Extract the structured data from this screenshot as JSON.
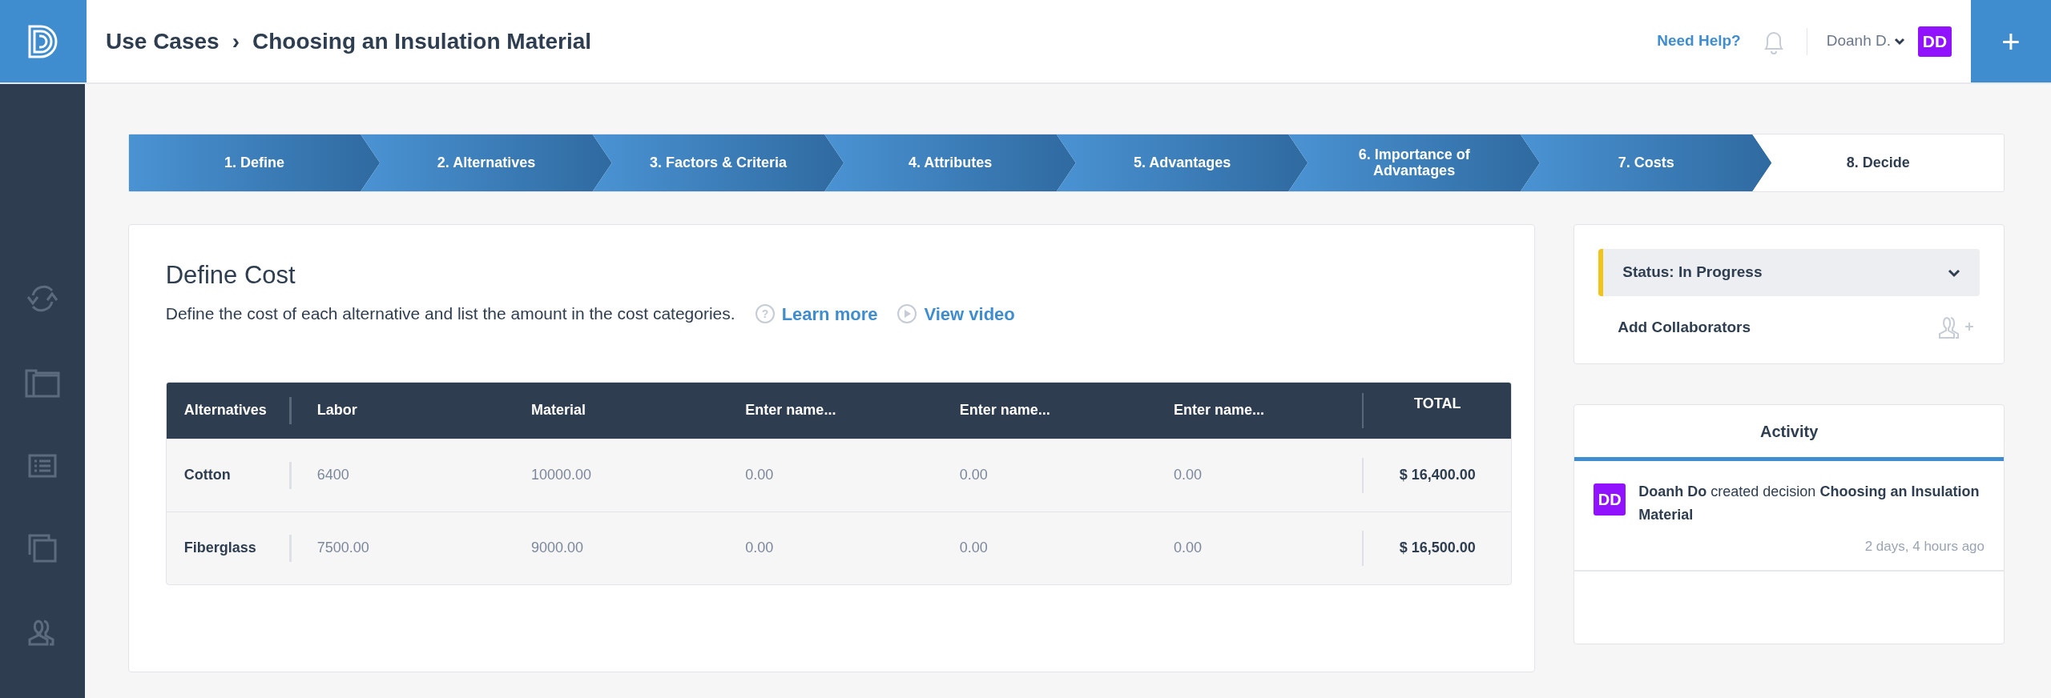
{
  "header": {
    "breadcrumb": [
      "Use Cases",
      "Choosing an Insulation Material"
    ],
    "separator": "›",
    "help_link": "Need Help?",
    "user_name": "Doanh D.",
    "user_initials": "DD",
    "add_button": "+"
  },
  "sidebar": {
    "items": [
      {
        "kind": "sync"
      },
      {
        "kind": "folders"
      },
      {
        "kind": "list"
      },
      {
        "kind": "copies"
      },
      {
        "kind": "people"
      }
    ]
  },
  "steps": [
    {
      "label": "1. Define",
      "completed": true
    },
    {
      "label": "2. Alternatives",
      "completed": true
    },
    {
      "label": "3. Factors & Criteria",
      "completed": true
    },
    {
      "label": "4. Attributes",
      "completed": true
    },
    {
      "label": "5. Advantages",
      "completed": true
    },
    {
      "label": "6. Importance of Advantages",
      "completed": true
    },
    {
      "label": "7. Costs",
      "completed": true
    },
    {
      "label": "8. Decide",
      "completed": false
    }
  ],
  "define_cost": {
    "title": "Define Cost",
    "description": "Define the cost of each alternative and list the amount in the cost categories.",
    "learn_more_icon": "?",
    "learn_more": "Learn more",
    "view_video": "View video",
    "table": {
      "first_column": "Alternatives",
      "total_column": "TOTAL",
      "columns": [
        {
          "kind": "named",
          "value": "Labor"
        },
        {
          "kind": "named",
          "value": "Material"
        },
        {
          "kind": "empty",
          "placeholder": "Enter name..."
        },
        {
          "kind": "empty",
          "placeholder": "Enter name..."
        },
        {
          "kind": "empty",
          "placeholder": "Enter name..."
        }
      ],
      "rows": [
        {
          "name": "Cotton",
          "values": [
            "6400",
            "10000.00",
            "0.00",
            "0.00",
            "0.00"
          ],
          "total": "$ 16,400.00"
        },
        {
          "name": "Fiberglass",
          "values": [
            "7500.00",
            "9000.00",
            "0.00",
            "0.00",
            "0.00"
          ],
          "total": "$ 16,500.00"
        }
      ]
    }
  },
  "status": {
    "label": "Status: In Progress",
    "color": "#f0c419"
  },
  "collaborators": {
    "label": "Add Collaborators"
  },
  "activity": {
    "tab": "Activity",
    "entries": [
      {
        "initials": "DD",
        "text": "**Doanh Do** created decision **Choosing an Insulation Material**",
        "time": "2 days, 4 hours ago"
      }
    ]
  }
}
